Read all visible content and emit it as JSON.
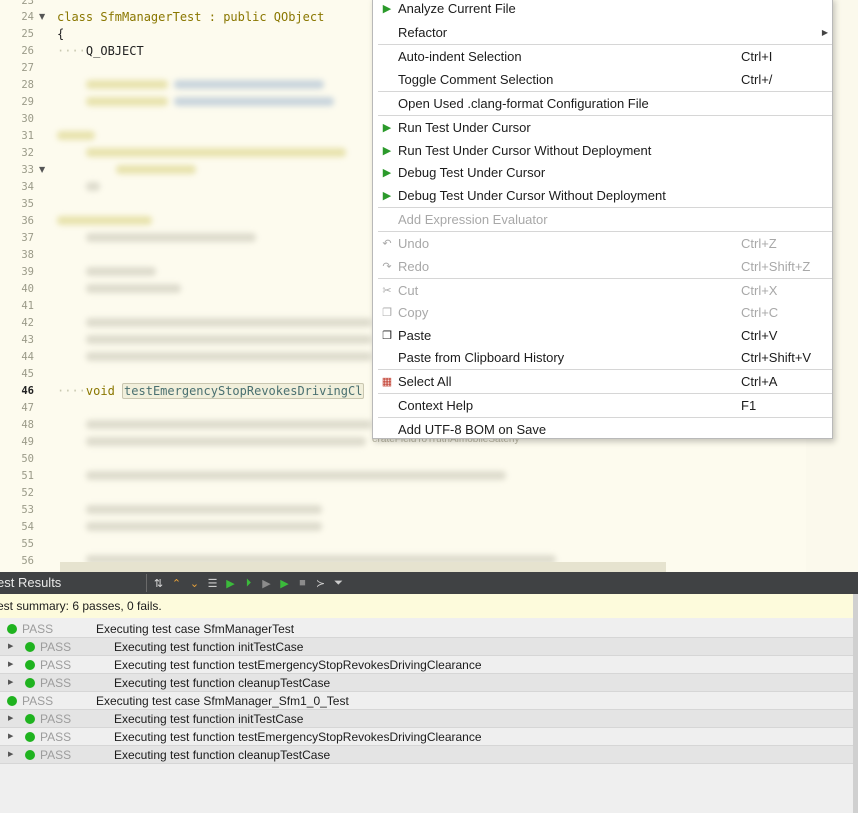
{
  "editor": {
    "line_numbers": [
      "24",
      "25",
      "26",
      "27",
      "28",
      "29",
      "30",
      "31",
      "32",
      "33",
      "34",
      "35",
      "36",
      "37",
      "38",
      "39",
      "40",
      "41",
      "42",
      "43",
      "44",
      "45",
      "46",
      "47",
      "48",
      "49",
      "50",
      "51",
      "52",
      "53",
      "54",
      "55",
      "56"
    ],
    "current_line": "46",
    "class_keyword": "class",
    "class_name": "SfmManagerTest",
    "class_rest": " : public QObject",
    "brace_open": "{",
    "macro": "Q_OBJECT",
    "void_keyword": "void",
    "function_name": "testEmergencyStopRevokesDrivingCl",
    "partial_text": "erateFieldToTruthAlmobileSaterly"
  },
  "context_menu": {
    "analyze": "Analyze Current File",
    "refactor": "Refactor",
    "auto_indent": {
      "label": "Auto-indent Selection",
      "shortcut": "Ctrl+I"
    },
    "toggle_comment": {
      "label": "Toggle Comment Selection",
      "shortcut": "Ctrl+/"
    },
    "clang_format": "Open Used .clang-format Configuration File",
    "run_test": "Run Test Under Cursor",
    "run_test_no_deploy": "Run Test Under Cursor Without Deployment",
    "debug_test": "Debug Test Under Cursor",
    "debug_test_no_deploy": "Debug Test Under Cursor Without Deployment",
    "add_expression": "Add Expression Evaluator",
    "undo": {
      "label": "Undo",
      "shortcut": "Ctrl+Z"
    },
    "redo": {
      "label": "Redo",
      "shortcut": "Ctrl+Shift+Z"
    },
    "cut": {
      "label": "Cut",
      "shortcut": "Ctrl+X"
    },
    "copy": {
      "label": "Copy",
      "shortcut": "Ctrl+C"
    },
    "paste": {
      "label": "Paste",
      "shortcut": "Ctrl+V"
    },
    "paste_history": {
      "label": "Paste from Clipboard History",
      "shortcut": "Ctrl+Shift+V"
    },
    "select_all": {
      "label": "Select All",
      "shortcut": "Ctrl+A"
    },
    "context_help": {
      "label": "Context Help",
      "shortcut": "F1"
    },
    "add_bom": "Add UTF-8 BOM on Save"
  },
  "test_results": {
    "title": "est Results",
    "summary": "est summary:  6 passes, 0 fails.",
    "rows": [
      {
        "status": "PASS",
        "text": "Executing test case SfmManagerTest",
        "level": 0
      },
      {
        "status": "PASS",
        "text": "Executing test function initTestCase",
        "level": 1
      },
      {
        "status": "PASS",
        "text": "Executing test function testEmergencyStopRevokesDrivingClearance",
        "level": 1
      },
      {
        "status": "PASS",
        "text": "Executing test function cleanupTestCase",
        "level": 1
      },
      {
        "status": "PASS",
        "text": "Executing test case SfmManager_Sfm1_0_Test",
        "level": 0
      },
      {
        "status": "PASS",
        "text": "Executing test function initTestCase",
        "level": 1
      },
      {
        "status": "PASS",
        "text": "Executing test function testEmergencyStopRevokesDrivingClearance",
        "level": 1
      },
      {
        "status": "PASS",
        "text": "Executing test function cleanupTestCase",
        "level": 1
      }
    ]
  },
  "colors": {
    "pass_green": "#1fb31f",
    "editor_bg": "#fdfbee",
    "keyword": "#8a7700"
  }
}
